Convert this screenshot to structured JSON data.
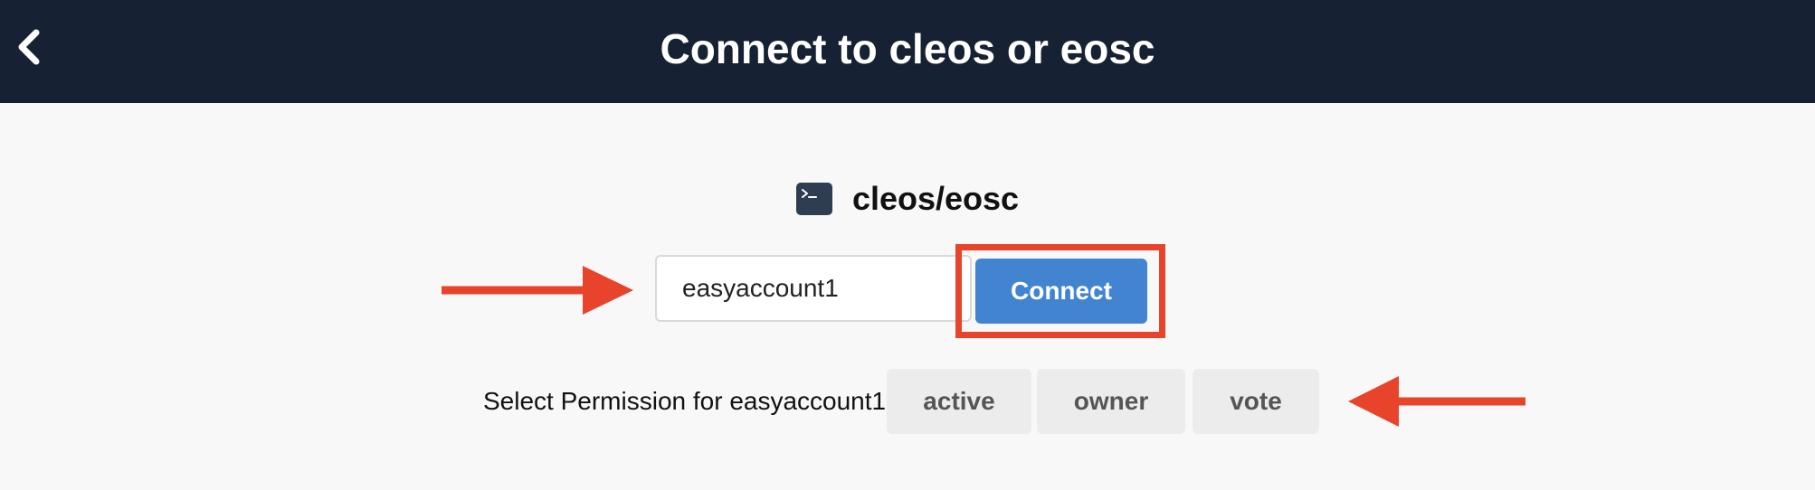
{
  "header": {
    "title": "Connect to cleos or eosc",
    "background": "#162133"
  },
  "app": {
    "name": "cleos/eosc",
    "icon": "terminal-icon"
  },
  "account_input": {
    "value": "easyaccount1"
  },
  "connect_button": {
    "label": "Connect",
    "color": "#4384d1"
  },
  "permissions": {
    "label": "Select Permission for easyaccount1:",
    "options": [
      "active",
      "owner",
      "vote"
    ]
  },
  "annotations": {
    "color": "#e8432b"
  }
}
